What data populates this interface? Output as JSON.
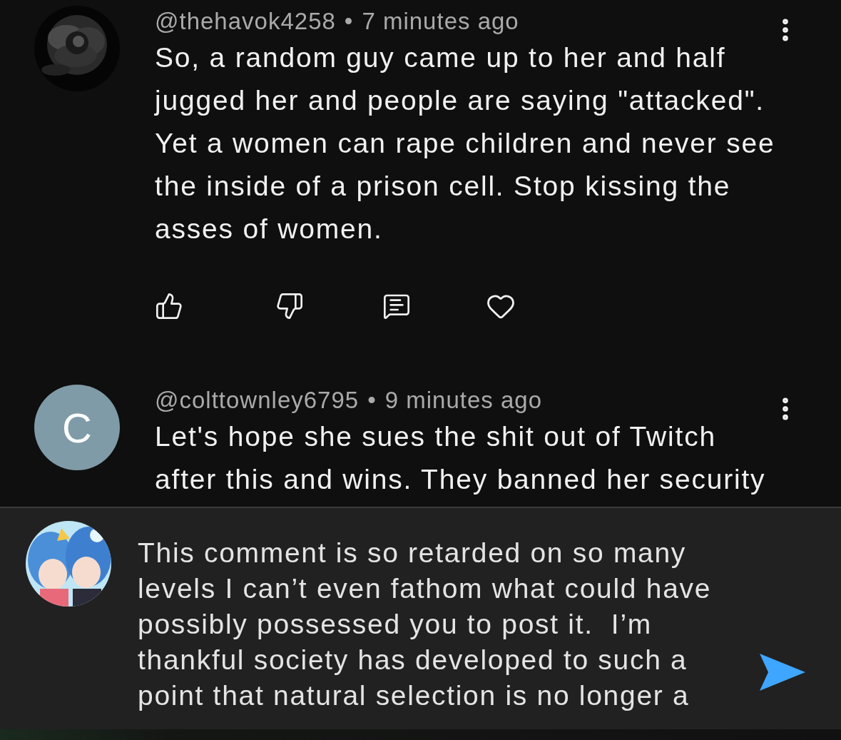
{
  "comments": [
    {
      "author": "@thehavok4258",
      "separator": "•",
      "time": "7 minutes ago",
      "body": "So, a random guy came up to her and half jugged her and people are saying \"attacked\". Yet a women can rape children and never see the inside of a prison cell. Stop kissing the asses of women.",
      "show_actions": true
    },
    {
      "author": "@colttownley6795",
      "separator": "•",
      "time": "9 minutes ago",
      "avatar": {
        "kind": "letter",
        "letter": "C"
      },
      "body": "Let's hope she sues the shit out of Twitch after this and wins. They banned her security",
      "show_actions": false
    }
  ],
  "composer": {
    "value": "This comment is so retarded on so many levels I can’t even fathom what could have possibly possessed you to post it.  I’m thankful society has developed to such a point that natural selection is no longer a"
  }
}
